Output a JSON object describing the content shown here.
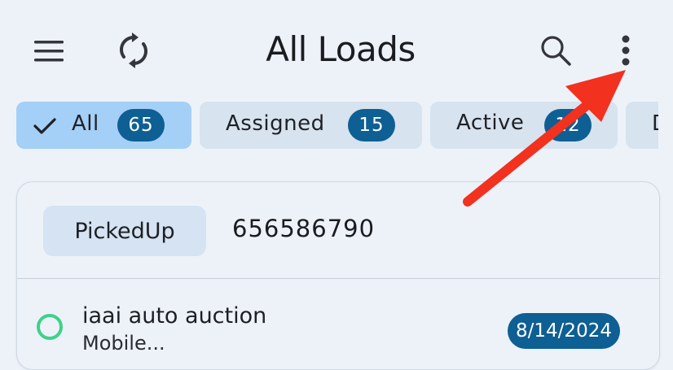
{
  "header": {
    "title": "All Loads",
    "menu_icon": "hamburger-menu-icon",
    "refresh_icon": "sync-icon",
    "search_icon": "search-icon",
    "more_icon": "more-vert-icon"
  },
  "filters": [
    {
      "label": "All",
      "count": "65",
      "selected": true
    },
    {
      "label": "Assigned",
      "count": "15",
      "selected": false
    },
    {
      "label": "Active",
      "count": "12",
      "selected": false
    },
    {
      "label": "D",
      "count": "",
      "selected": false
    }
  ],
  "load_card": {
    "status": "PickedUp",
    "load_number": "656586790",
    "pickup_name": "iaai auto auction",
    "pickup_detail": "Mobile...",
    "date": "8/14/2024"
  },
  "colors": {
    "accent": "#0e5f93",
    "chip_selected": "#a4cff7",
    "annotation_arrow": "#f2311f",
    "status_circle": "#3fd18a"
  }
}
